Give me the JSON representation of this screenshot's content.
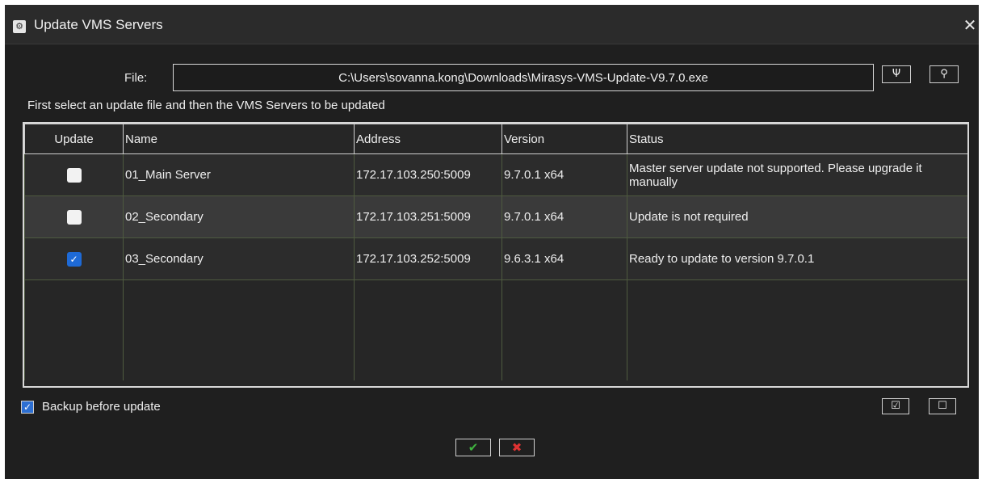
{
  "window": {
    "title": "Update VMS Servers",
    "icon": "gears-icon",
    "close_icon": "close-icon"
  },
  "file": {
    "label": "File:",
    "value": "C:\\Users\\sovanna.kong\\Downloads\\Mirasys-VMS-Update-V9.7.0.exe",
    "tools_icon": "tools-icon",
    "browse_icon": "search-icon"
  },
  "hint": "First select an update file and then the VMS Servers to be updated",
  "grid": {
    "columns": [
      "Update",
      "Name",
      "Address",
      "Version",
      "Status"
    ],
    "rows": [
      {
        "checked": false,
        "name": "01_Main Server",
        "address": "172.17.103.250:5009",
        "version": "9.7.0.1 x64",
        "status": "Master server update not supported. Please upgrade it manually"
      },
      {
        "checked": false,
        "name": "02_Secondary",
        "address": "172.17.103.251:5009",
        "version": "9.7.0.1 x64",
        "status": "Update is not required"
      },
      {
        "checked": true,
        "name": "03_Secondary",
        "address": "172.17.103.252:5009",
        "version": "9.6.3.1 x64",
        "status": "Ready to update to version 9.7.0.1"
      }
    ]
  },
  "backup": {
    "label": "Backup before update",
    "checked": true
  },
  "select_buttons": {
    "select_all_icon": "check-all-icon",
    "clear_all_icon": "uncheck-all-icon"
  },
  "actions": {
    "ok_icon": "checkmark-icon",
    "cancel_icon": "cross-icon",
    "ok_color": "#3fb23f",
    "cancel_color": "#e03232"
  }
}
